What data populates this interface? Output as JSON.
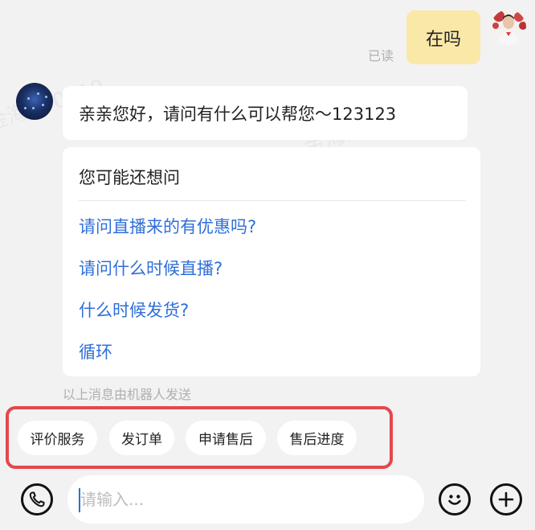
{
  "watermark": {
    "text": "金海萍 0719"
  },
  "outgoing": {
    "text": "在吗",
    "status": "已读"
  },
  "incoming": {
    "greeting": "亲亲您好，请问有什么可以帮您～123123",
    "faq_title": "您可能还想问",
    "faq_items": [
      "请问直播来的有优惠吗?",
      "请问什么时候直播?",
      "什么时候发货?",
      "循环"
    ],
    "note": "以上消息由机器人发送"
  },
  "quick_actions": [
    "评价服务",
    "发订单",
    "申请售后",
    "售后进度"
  ],
  "composer": {
    "placeholder": "请输入..."
  },
  "icons": {
    "phone": "phone-icon",
    "emoji": "emoji-icon",
    "add": "add-icon"
  },
  "colors": {
    "outgoing_bubble": "#fae8a8",
    "link": "#2f6fd8",
    "highlight_border": "#e5474b",
    "background": "#f2f2f2"
  }
}
